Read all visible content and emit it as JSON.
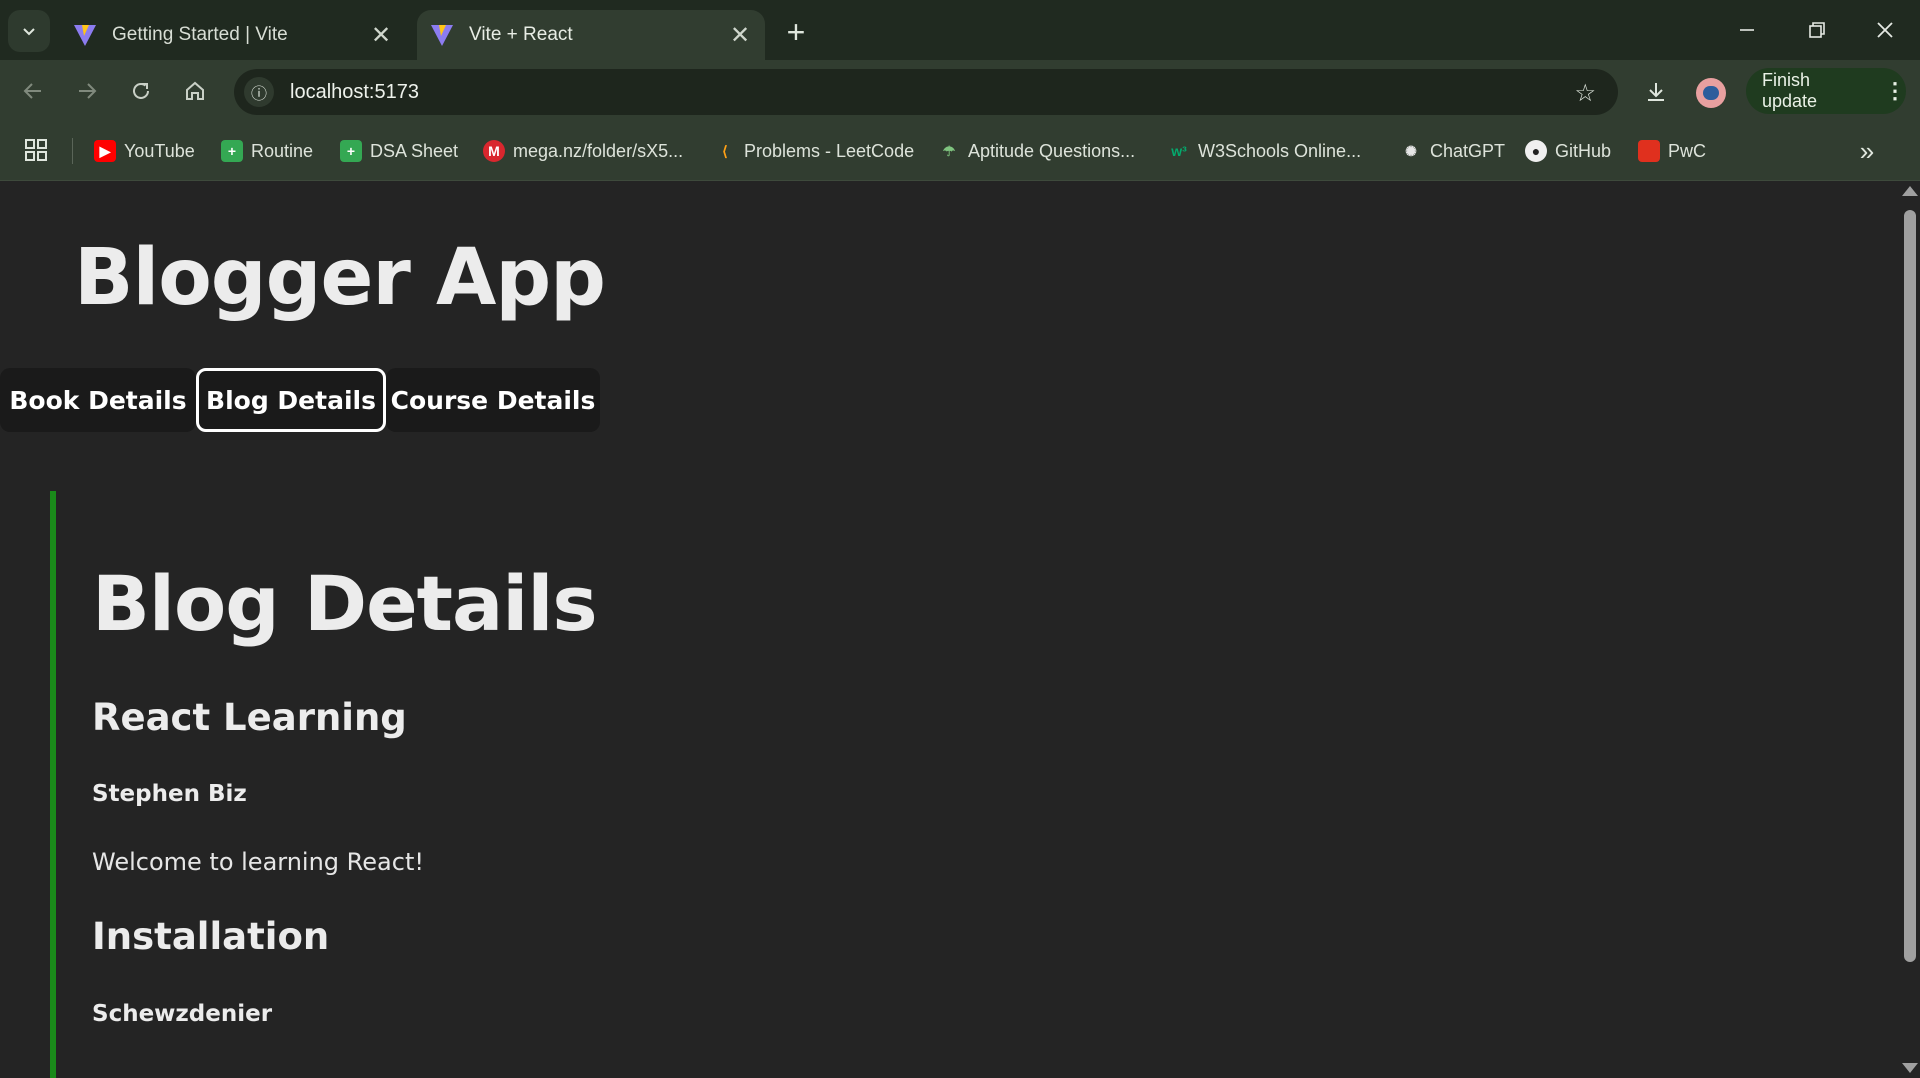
{
  "browser": {
    "tabs": [
      {
        "title": "Getting Started | Vite",
        "active": false
      },
      {
        "title": "Vite + React",
        "active": true
      }
    ],
    "url": "localhost:5173",
    "update_label": "Finish update",
    "bookmarks": [
      {
        "label": "YouTube",
        "icon": "youtube-icon",
        "color": "#ff0000"
      },
      {
        "label": "Routine",
        "icon": "sheets-icon",
        "color": "#34a853"
      },
      {
        "label": "DSA Sheet",
        "icon": "sheets-icon",
        "color": "#34a853"
      },
      {
        "label": "mega.nz/folder/sX5...",
        "icon": "mega-icon",
        "color": "#d9272e"
      },
      {
        "label": "Problems - LeetCode",
        "icon": "leetcode-icon",
        "color": "#ffa116"
      },
      {
        "label": "Aptitude Questions...",
        "icon": "indiabix-icon",
        "color": "#4caf50"
      },
      {
        "label": "W3Schools Online...",
        "icon": "w3schools-icon",
        "color": "#04aa6d"
      },
      {
        "label": "ChatGPT",
        "icon": "chatgpt-icon",
        "color": "#ffffff"
      },
      {
        "label": "GitHub",
        "icon": "github-icon",
        "color": "#ffffff"
      },
      {
        "label": "PwC",
        "icon": "pwc-icon",
        "color": "#e0301e"
      }
    ]
  },
  "app": {
    "title": "Blogger App",
    "nav": [
      {
        "label": "Book Details"
      },
      {
        "label": "Blog Details"
      },
      {
        "label": "Course Details"
      }
    ],
    "selected_nav": "Blog Details"
  },
  "blog": {
    "heading": "Blog Details",
    "posts": [
      {
        "title": "React Learning",
        "author": "Stephen Biz",
        "content": "Welcome to learning React!"
      },
      {
        "title": "Installation",
        "author": "Schewzdenier",
        "content": ""
      }
    ]
  },
  "colors": {
    "section_border": "#1a8a1a",
    "page_bg": "#242424",
    "chrome_bg": "#313d30"
  }
}
